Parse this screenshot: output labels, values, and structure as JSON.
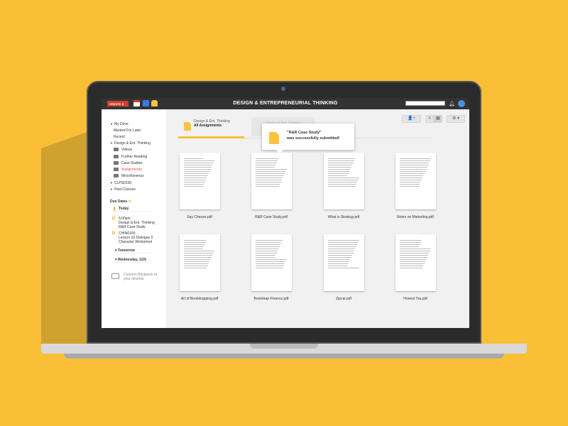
{
  "topbar": {
    "create_label": "CREATE",
    "title": "DESIGN & ENTREPRENEURIAL THINKING"
  },
  "sidebar": {
    "items": [
      {
        "label": "My Drive",
        "level": 0,
        "expander": true
      },
      {
        "label": "Marked For Later",
        "level": 1
      },
      {
        "label": "Recent",
        "level": 1
      },
      {
        "label": "Design & Ent. Thinking",
        "level": 0,
        "expander": true
      },
      {
        "label": "Videos",
        "level": 2
      },
      {
        "label": "Further Reading",
        "level": 2
      },
      {
        "label": "Case Studies",
        "level": 2
      },
      {
        "label": "Assignments",
        "level": 2,
        "active": true
      },
      {
        "label": "Miscellaneous",
        "level": 2
      },
      {
        "label": "CLPS0100",
        "level": 0,
        "expander": true
      },
      {
        "label": "Past Courses",
        "level": 0,
        "expander": true
      }
    ],
    "due_dates": {
      "title": "Due Dates",
      "today": "Today",
      "tasks": [
        {
          "time": "5:00pm",
          "course": "Design & Ent. Thinking",
          "name": "R&R Case Study"
        },
        {
          "time": "CHIN0100",
          "course": "Lesson 10 Dialogue 2",
          "name": "Character Worksheet"
        }
      ],
      "tomorrow": "Tomorrow",
      "wednesday": "Wednesday,  1/29"
    },
    "connect": "Connect Backpack to your desktop"
  },
  "tabs": [
    {
      "course": "Design & Ent. Thinking",
      "label": "All Assignments",
      "active": true
    },
    {
      "course": "Design & Ent. Thinking",
      "label": ""
    }
  ],
  "toast": {
    "line1": "\"R&R Case Study\"",
    "line2": "was successfully submitted!"
  },
  "files": [
    "Say Cheese.pdf",
    "R&R Case Study.pdf",
    "What is Strategy.pdf",
    "Notes on Marketing.pdf",
    "Art of Bootstrapping.pdf",
    "Bootstrap Finance.pdf",
    "Zipcar.pdf",
    "Honest Tea.pdf"
  ],
  "colors": {
    "background": "#F8BF37",
    "accent": "#F8BF37",
    "active_link": "#e0533e"
  }
}
